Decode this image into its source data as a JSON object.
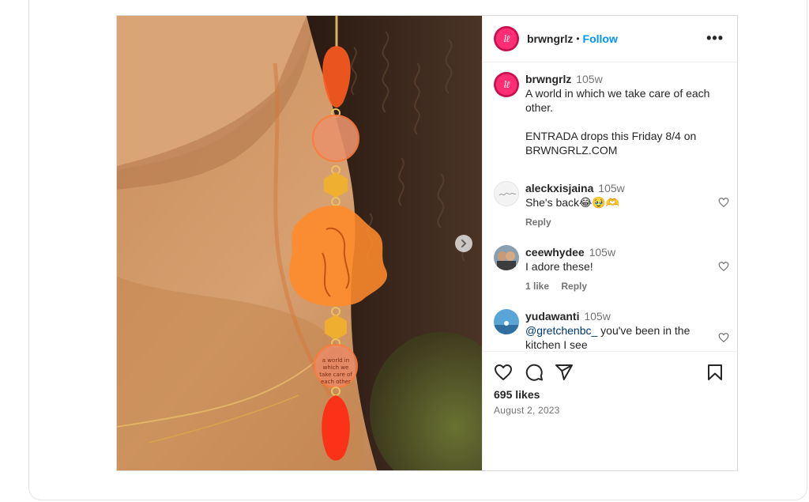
{
  "post": {
    "username": "brwngrlz",
    "follow_label": "Follow",
    "separator": "•",
    "more_label": "•••",
    "avatar_text": "lℓ"
  },
  "caption": {
    "username": "brwngrlz",
    "time": "105w",
    "text": "A world in which we take care of each other.\n\nENTRADA drops this Friday 8/4 on BRWNGRLZ.COM"
  },
  "comments": [
    {
      "username": "aleckxisjaina",
      "time": "105w",
      "text": "She's back😂🥹🫶",
      "reply_label": "Reply"
    },
    {
      "username": "ceewhydee",
      "time": "105w",
      "text": "I adore these!",
      "likes_label": "1 like",
      "reply_label": "Reply"
    },
    {
      "username": "yudawanti",
      "time": "105w",
      "mention": "@gretchenbc_",
      "text": " you've been in the kitchen I see"
    }
  ],
  "footer": {
    "likes": "695 likes",
    "date": "August 2, 2023"
  },
  "media": {
    "earring_text": "a world in which we take care of each other",
    "alt": "Orange acrylic earring"
  },
  "colors": {
    "accent": "#0095f6",
    "brand": "#ff2d74",
    "mention": "#00376b"
  },
  "icons": [
    "next-arrow-icon",
    "heart-icon",
    "comment-icon",
    "share-icon",
    "bookmark-icon",
    "more-icon"
  ]
}
